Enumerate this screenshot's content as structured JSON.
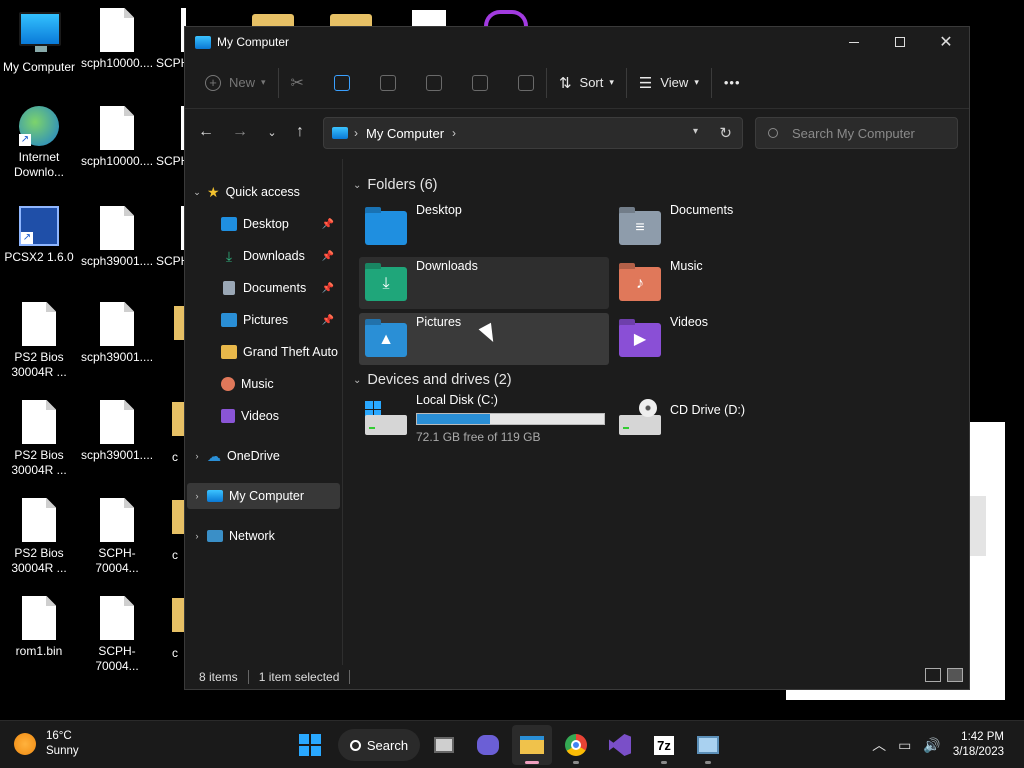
{
  "desktop": {
    "icons": [
      {
        "label": "My Computer"
      },
      {
        "label": "scph10000...."
      },
      {
        "label": "SCPH"
      },
      {
        "label": "Internet Downlo..."
      },
      {
        "label": "scph10000...."
      },
      {
        "label": "SCPH"
      },
      {
        "label": "PCSX2 1.6.0"
      },
      {
        "label": "scph39001...."
      },
      {
        "label": "SCPH"
      },
      {
        "label": "PS2 Bios 30004R ..."
      },
      {
        "label": "scph39001...."
      },
      {
        "label": "PS2 Bios 30004R ..."
      },
      {
        "label": "scph39001...."
      },
      {
        "label": "c"
      },
      {
        "label": "PS2 Bios 30004R ..."
      },
      {
        "label": "SCPH-70004..."
      },
      {
        "label": "c"
      },
      {
        "label": "rom1.bin"
      },
      {
        "label": "SCPH-70004..."
      },
      {
        "label": "c"
      }
    ]
  },
  "window": {
    "title": "My Computer",
    "controls": {
      "minimize": "—",
      "maximize": "☐",
      "close": "✕"
    }
  },
  "toolbar": {
    "new_label": "New",
    "sort_label": "Sort",
    "view_label": "View",
    "more_label": "•••"
  },
  "address": {
    "path": "My Computer",
    "search_placeholder": "Search My Computer"
  },
  "nav": {
    "quick_access": "Quick access",
    "items": [
      {
        "label": "Desktop",
        "color": "#1f8fe0"
      },
      {
        "label": "Downloads",
        "color": "#2fb37f"
      },
      {
        "label": "Documents",
        "color": "#9aa7b5"
      },
      {
        "label": "Pictures",
        "color": "#2a8fd6"
      },
      {
        "label": "Grand Theft Auto -",
        "color": "#e8b84a"
      },
      {
        "label": "Music",
        "color": "#e0785a"
      },
      {
        "label": "Videos",
        "color": "#8a55d6"
      }
    ],
    "onedrive": "OneDrive",
    "my_computer": "My Computer",
    "network": "Network"
  },
  "content": {
    "folders_header": "Folders (6)",
    "folders": [
      {
        "name": "Desktop",
        "color": "#1f8fe0"
      },
      {
        "name": "Documents",
        "color": "#8e9cab"
      },
      {
        "name": "Downloads",
        "color": "#1fa67a"
      },
      {
        "name": "Music",
        "color": "#e0785a"
      },
      {
        "name": "Pictures",
        "color": "#2a8fd6"
      },
      {
        "name": "Videos",
        "color": "#8a4fd6"
      }
    ],
    "drives_header": "Devices and drives (2)",
    "drives": [
      {
        "name": "Local Disk (C:)",
        "free": "72.1 GB free of 119 GB",
        "used_fraction": 0.39
      },
      {
        "name": "CD Drive (D:)"
      }
    ]
  },
  "status": {
    "items": "8 items",
    "selected": "1 item selected"
  },
  "taskbar": {
    "temp": "16°C",
    "condition": "Sunny",
    "search_label": "Search",
    "time": "1:42 PM",
    "date": "3/18/2023",
    "app_7z_label": "7z"
  }
}
